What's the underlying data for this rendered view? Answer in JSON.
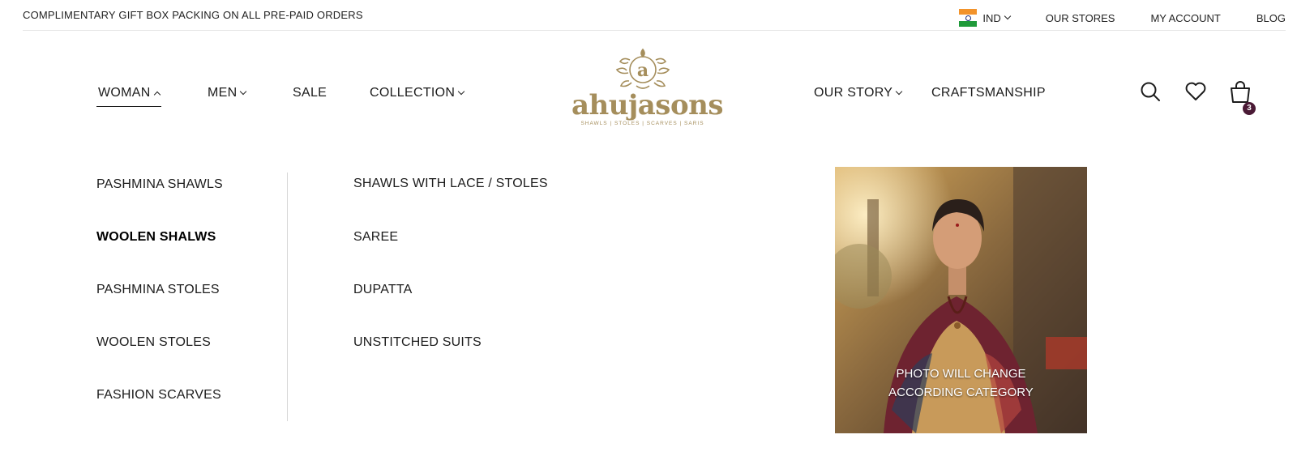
{
  "topbar": {
    "promo": "COMPLIMENTARY GIFT BOX PACKING ON ALL PRE-PAID ORDERS",
    "country": "IND",
    "stores": "OUR STORES",
    "account": "MY ACCOUNT",
    "blog": "BLOG"
  },
  "nav": {
    "woman": "WOMAN",
    "men": "MEN",
    "sale": "SALE",
    "collection": "COLLECTION",
    "our_story": "OUR STORY",
    "craftsmanship": "CRAFTSMANSHIP"
  },
  "logo": {
    "brand": "ahujasons",
    "tagline": "SHAWLS | STOLES | SCARVES | SARIS"
  },
  "cart": {
    "count": "3"
  },
  "megamenu": {
    "col1": [
      "PASHMINA SHAWLS",
      "WOOLEN SHALWS",
      "PASHMINA STOLES",
      "WOOLEN STOLES",
      "FASHION SCARVES"
    ],
    "col2": [
      "SHAWLS WITH LACE / STOLES",
      "SAREE",
      "DUPATTA",
      "UNSTITCHED SUITS"
    ],
    "photo_caption_line1": "PHOTO WILL CHANGE",
    "photo_caption_line2": "ACCORDING CATEGORY"
  },
  "colors": {
    "brand_gold": "#a58e5c",
    "badge": "#4a1a35"
  },
  "icons": [
    "india-flag-icon",
    "search-icon",
    "heart-icon",
    "shopping-bag-icon",
    "chevron-down-icon",
    "chevron-up-icon"
  ]
}
